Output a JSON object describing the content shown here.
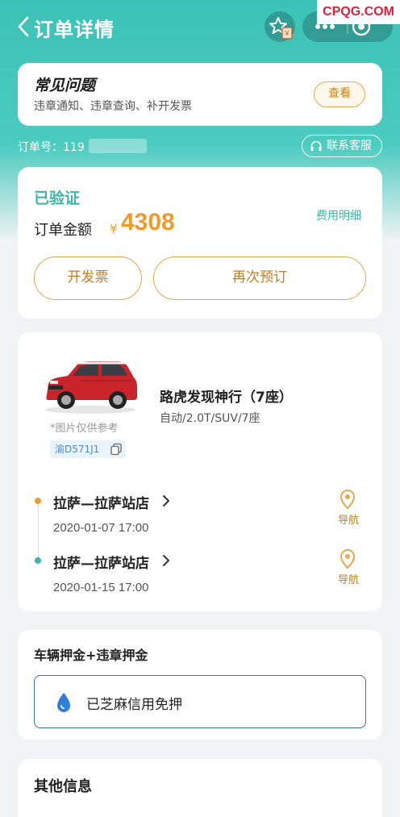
{
  "header": {
    "title": "订单详情",
    "watermark": "CPQG.COM"
  },
  "faq": {
    "title": "常见问题",
    "subtitle": "违章通知、违章查询、补开发票",
    "button": "查看"
  },
  "order": {
    "number_label": "订单号：119",
    "service_label": "联系客服"
  },
  "status": {
    "label": "已验证",
    "amount_label": "订单金额",
    "currency": "¥",
    "amount": "4308",
    "fee_detail_link": "费用明细",
    "invoice_button": "开发票",
    "rebook_button": "再次预订"
  },
  "car": {
    "image_note": "*图片仅供参考",
    "plate": "渝D571J1",
    "name": "路虎发现神行（7座）",
    "spec": "自动/2.0T/SUV/7座",
    "color": "#c8242a"
  },
  "trip": {
    "pickup": {
      "location": "拉萨—拉萨站店",
      "time": "2020-01-07 17:00",
      "nav_label": "导航"
    },
    "return": {
      "location": "拉萨—拉萨站店",
      "time": "2020-01-15 17:00",
      "nav_label": "导航"
    }
  },
  "deposit": {
    "title": "车辆押金+违章押金",
    "status_text": "已芝麻信用免押"
  },
  "other": {
    "title": "其他信息"
  },
  "colors": {
    "primary": "#3cc2b6",
    "accent": "#f09a2a",
    "button_border": "#e5a84d"
  }
}
